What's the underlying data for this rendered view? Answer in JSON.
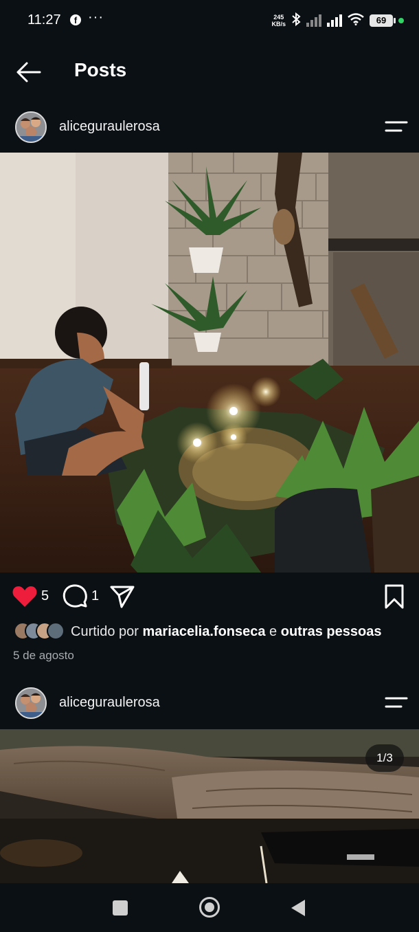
{
  "status_bar": {
    "time": "11:27",
    "notification_icons": [
      "facebook-icon",
      "more-dots-icon"
    ],
    "more": "···",
    "net_speed_value": "245",
    "net_speed_unit": "KB/s",
    "battery": "69",
    "icons": [
      "bluetooth-icon",
      "signal-icon",
      "wifi-icon",
      "battery-icon"
    ]
  },
  "header": {
    "title": "Posts",
    "back_icon": "arrow-left-icon"
  },
  "posts": [
    {
      "username": "aliceguraulerosa",
      "actions": {
        "likes": "5",
        "comments": "1",
        "liked": true,
        "like_color": "#ee1d3c"
      },
      "liked_by_prefix": "Curtido por ",
      "liked_by_user": "mariacelia.fonseca",
      "liked_by_middle": " e ",
      "liked_by_suffix": "outras pessoas",
      "date": "5 de agosto"
    },
    {
      "username": "aliceguraulerosa",
      "counter": "1/3"
    }
  ],
  "nav": {
    "icons": [
      "recents-square-icon",
      "home-circle-icon",
      "back-triangle-icon"
    ]
  },
  "colors": {
    "background": "#0b1014",
    "accent_like": "#ee1d3c"
  }
}
